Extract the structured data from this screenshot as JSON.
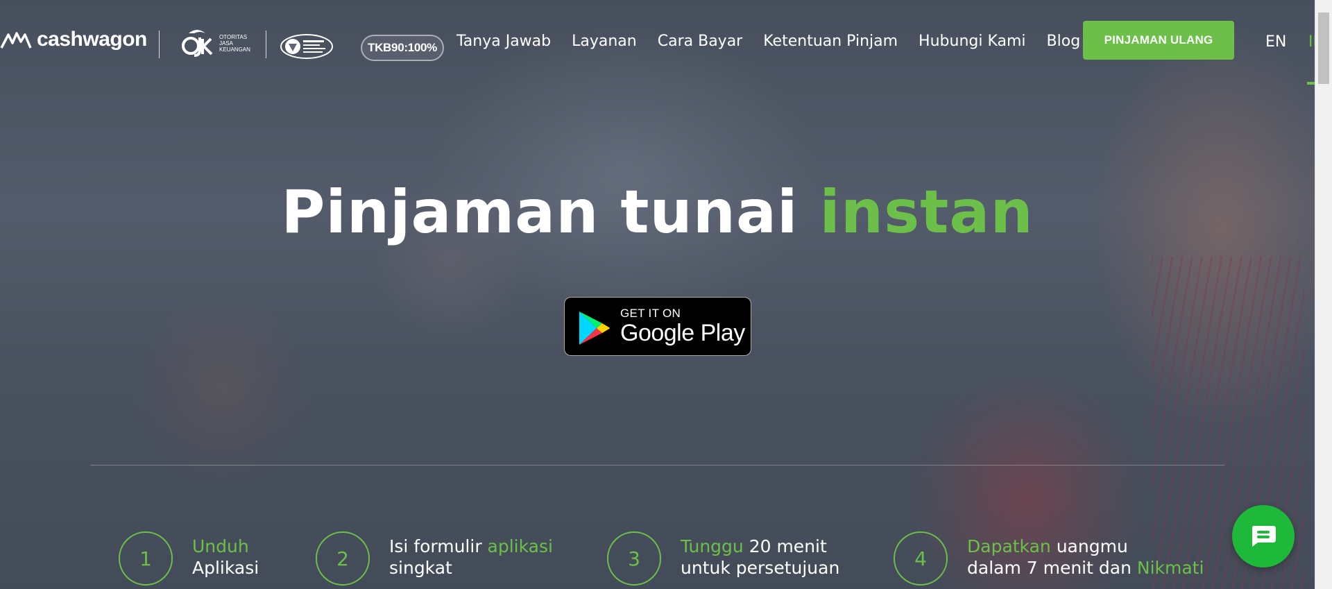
{
  "brand": {
    "logo_text": "cashwagon",
    "ojk_lines": [
      "OTORITAS",
      "JASA",
      "KEUANGAN"
    ],
    "ojk_mark": "OJK",
    "iso_text": "ISO/IEC 27001",
    "tkb": "TKB90:100%"
  },
  "nav": {
    "items": [
      "Tanya Jawab",
      "Layanan",
      "Cara Bayar",
      "Ketentuan Pinjam",
      "Hubungi Kami",
      "Blog"
    ],
    "cta": "PINJAMAN ULANG",
    "lang_en": "EN",
    "lang_id": "ID"
  },
  "hero": {
    "title_main": "Pinjaman tunai ",
    "title_accent": "instan",
    "store": {
      "small": "GET IT ON",
      "big": "Google Play"
    }
  },
  "steps": [
    {
      "num": "1",
      "green1": "Unduh",
      "white1": "",
      "line2_white": "Aplikasi",
      "line2_green": ""
    },
    {
      "num": "2",
      "green1": "",
      "white1": "Isi formulir ",
      "green1b": "aplikasi",
      "line2_white": "singkat",
      "line2_green": ""
    },
    {
      "num": "3",
      "green1": "Tunggu",
      "white1": " 20 menit",
      "line2_white": "untuk persetujuan",
      "line2_green": ""
    },
    {
      "num": "4",
      "green1": "Dapatkan",
      "white1": " uangmu",
      "line2_white": "dalam 7 menit dan ",
      "line2_green": "Nikmati"
    }
  ],
  "colors": {
    "accent": "#6cc04a",
    "chat": "#1eb83a"
  },
  "icons": {
    "chat": "chat-bubble-icon",
    "play": "google-play-icon",
    "logo": "cashwagon-logo-icon"
  }
}
